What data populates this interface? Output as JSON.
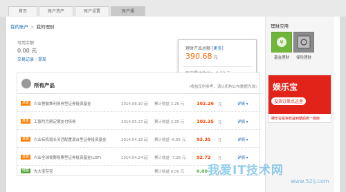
{
  "nav": {
    "tabs": [
      "首页",
      "账户资产",
      "账户设置",
      "账户通"
    ]
  },
  "breadcrumb": {
    "home": "我的账户",
    "sep": ">",
    "current": "我的理财"
  },
  "balance": {
    "label": "可用余额",
    "value": "0.00 元",
    "link_records": "交易记录",
    "link_withdraw": "提现"
  },
  "popup": {
    "label": "理财产品总额",
    "more": "[更多]",
    "value": "390.68",
    "unit": "元",
    "history": "历史累计收益：-9.32 元"
  },
  "sidebar": {
    "title": "理财应用",
    "apps": [
      {
        "label": "基金理财"
      },
      {
        "label": "保险理财"
      }
    ],
    "banner": {
      "title": "娱乐宝",
      "cta": "投资订单点这里",
      "sub": "娱乐宝投资收益到期后统一揭晓"
    }
  },
  "products": {
    "title": "所有产品",
    "note": "(收益仅供参考，请以机构公布数据为准)",
    "detail_label": "详情",
    "rows": [
      {
        "badge": "基金",
        "name": "兴业警敏季利债券型证券投资基金",
        "date": "2014.06.10 起",
        "gain": "累计收益 2.26 元",
        "amount": "102.26",
        "unit": "元"
      },
      {
        "badge": "基金",
        "name": "工银月月薪定期支付债券",
        "date": "2014.05.27 起",
        "gain": "累计收益 2.35 元",
        "amount": "102.35",
        "unit": "元"
      },
      {
        "badge": "基金",
        "name": "兴业有机增长灵活配置混合型证券投资基金",
        "date": "2014.04.16 起",
        "gain": "累计收益 -6.65 元",
        "amount": "93.35",
        "unit": "元"
      },
      {
        "badge": "基金",
        "name": "兴业全球视野股票型证券投资基金(LOF)",
        "date": "2014.04.24 起",
        "gain": "累计收益 -7.28 元",
        "amount": "92.72",
        "unit": "元"
      },
      {
        "badge": "储蓄",
        "name": "先大宝存宝",
        "date": "",
        "gain": "累计收益 0.00 元",
        "amount": "0.00",
        "unit": "元",
        "green": true
      }
    ]
  },
  "watermark": {
    "text": "我爱IT技术网",
    "url": "www.52ij.com"
  }
}
